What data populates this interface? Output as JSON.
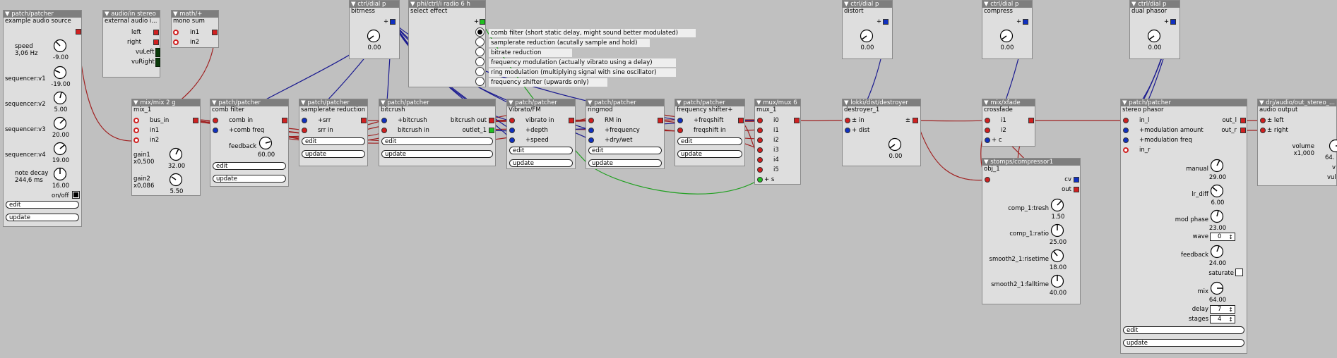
{
  "objects": {
    "src": {
      "type": "patch/patcher",
      "name": "example audio source",
      "outlet": "",
      "speed_label": "speed",
      "speed_val": "3,06 Hz",
      "speed_dial": "-9.00",
      "seq1": "sequencer:v1",
      "seq1_val": "-19.00",
      "seq2": "sequencer:v2",
      "seq2_val": "5.00",
      "seq3": "sequencer:v3",
      "seq3_val": "20.00",
      "seq4": "sequencer:v4",
      "seq4_val": "19.00",
      "decay_label": "note decay",
      "decay_ms": "244,6 ms",
      "decay_val": "16.00",
      "onoff": "on/off",
      "edit": "edit",
      "update": "update"
    },
    "audioin": {
      "type": "audio/in stereo",
      "name": "external audio i...",
      "left": "left",
      "right": "right",
      "vuLeft": "vuLeft",
      "vuRight": "vuRight"
    },
    "mono": {
      "type": "math/+",
      "name": "mono sum",
      "in1": "in1",
      "in2": "in2"
    },
    "bitrness": {
      "type": "ctrl/dial p",
      "name": "bitrness",
      "val": "0.00"
    },
    "radio": {
      "type": "phi/ctrl/i radio 6 h",
      "name": "select effect",
      "options": [
        "comb filter (short static delay, might sound better modulated)",
        "samplerate reduction (acutally sample and hold)",
        "bitrate reduction",
        "frequency modulation (actually vibrato using a delay)",
        "ring modulation (multiplying signal with sine oscillator)",
        "frequency shifter (upwards only)"
      ]
    },
    "mix": {
      "type": "mix/mix 2 g",
      "name": "mix_1",
      "bus_in": "bus_in",
      "in1": "in1",
      "in2": "in2",
      "gain1": "gain1",
      "gain1_val": "x0,500",
      "gain1_dial": "32.00",
      "gain2": "gain2",
      "gain2_val": "x0,086",
      "gain2_dial": "5.50"
    },
    "comb": {
      "type": "patch/patcher",
      "name": "comb filter",
      "in1": "comb in",
      "in2": "+comb freq",
      "feedback": "feedback",
      "feedback_val": "60.00",
      "edit": "edit",
      "update": "update"
    },
    "srr": {
      "type": "patch/patcher",
      "name": "samplerate reduction",
      "in1": "+srr",
      "in2": "srr in",
      "edit": "edit",
      "update": "update"
    },
    "bitc": {
      "type": "patch/patcher",
      "name": "bitcrush",
      "in1": "+bitcrush",
      "in2": "bitcrush in",
      "out1": "bitcrush out",
      "out2": "outlet_1",
      "edit": "edit",
      "update": "update"
    },
    "vib": {
      "type": "patch/patcher",
      "name": "Vibrato/FM",
      "in1": "vibrato in",
      "in2": "+depth",
      "in3": "+speed",
      "edit": "edit",
      "update": "update"
    },
    "ring": {
      "type": "patch/patcher",
      "name": "ringmod",
      "in1": "RM in",
      "in2": "+frequency",
      "in3": "+dry/wet",
      "edit": "edit",
      "update": "update"
    },
    "fshift": {
      "type": "patch/patcher",
      "name": "frequency shifter+",
      "in1": "+freqshift",
      "in2": "freqshift in",
      "edit": "edit",
      "update": "update"
    },
    "mux": {
      "type": "mux/mux 6",
      "name": "mux_1",
      "inputs": [
        "i0",
        "i1",
        "i2",
        "i3",
        "i4",
        "i5"
      ],
      "s": "s"
    },
    "distort": {
      "type": "ctrl/dial p",
      "name": "distort",
      "val": "0.00"
    },
    "destroyer": {
      "type": "lokki/dist/destroyer",
      "name": "destroyer_1",
      "in": "in",
      "dist": "dist",
      "val": "0.00",
      "out": "±"
    },
    "compress": {
      "type": "ctrl/dial p",
      "name": "compress",
      "val": "0.00"
    },
    "xfade": {
      "type": "mix/xfade",
      "name": "crossfade",
      "i1": "i1",
      "i2": "i2",
      "c": "c"
    },
    "comp": {
      "type": "stomps/compressor1",
      "name": "obj_1",
      "cv": "cv",
      "out": "out",
      "tresh": "comp_1:tresh",
      "tresh_val": "1.50",
      "ratio": "comp_1:ratio",
      "ratio_val": "25.00",
      "rise": "smooth2_1:risetime",
      "rise_val": "18.00",
      "fall": "smooth2_1:falltime",
      "fall_val": "40.00"
    },
    "dphasor": {
      "type": "ctrl/dial p",
      "name": "dual phasor",
      "val": "0.00"
    },
    "phasor": {
      "type": "patch/patcher",
      "name": "stereo phasor",
      "in_l": "in_l",
      "mod_amount": "+modulation amount",
      "mod_freq": "+modulation freq",
      "in_r": "in_r",
      "out_l": "out_l",
      "out_r": "out_r",
      "manual": "manual",
      "manual_val": "29.00",
      "lr_diff": "lr_diff",
      "lr_diff_val": "6.00",
      "mod_phase": "mod phase",
      "mod_phase_val": "23.00",
      "wave": "wave",
      "wave_val": "0",
      "feedback": "feedback",
      "feedback_val": "24.00",
      "saturate": "saturate",
      "mix": "mix",
      "mix_val": "64.00",
      "delay": "delay",
      "delay_val": "7",
      "stages": "stages",
      "stages_val": "4",
      "edit": "edit",
      "update": "update"
    },
    "aout": {
      "type": "drj/audio/out_stereo_...",
      "name": "audio output",
      "left": "left",
      "right": "right",
      "volume": "volume",
      "volume_val": "x1,000",
      "dial_val": "64.",
      "v": "v",
      "vul": "vul"
    }
  }
}
